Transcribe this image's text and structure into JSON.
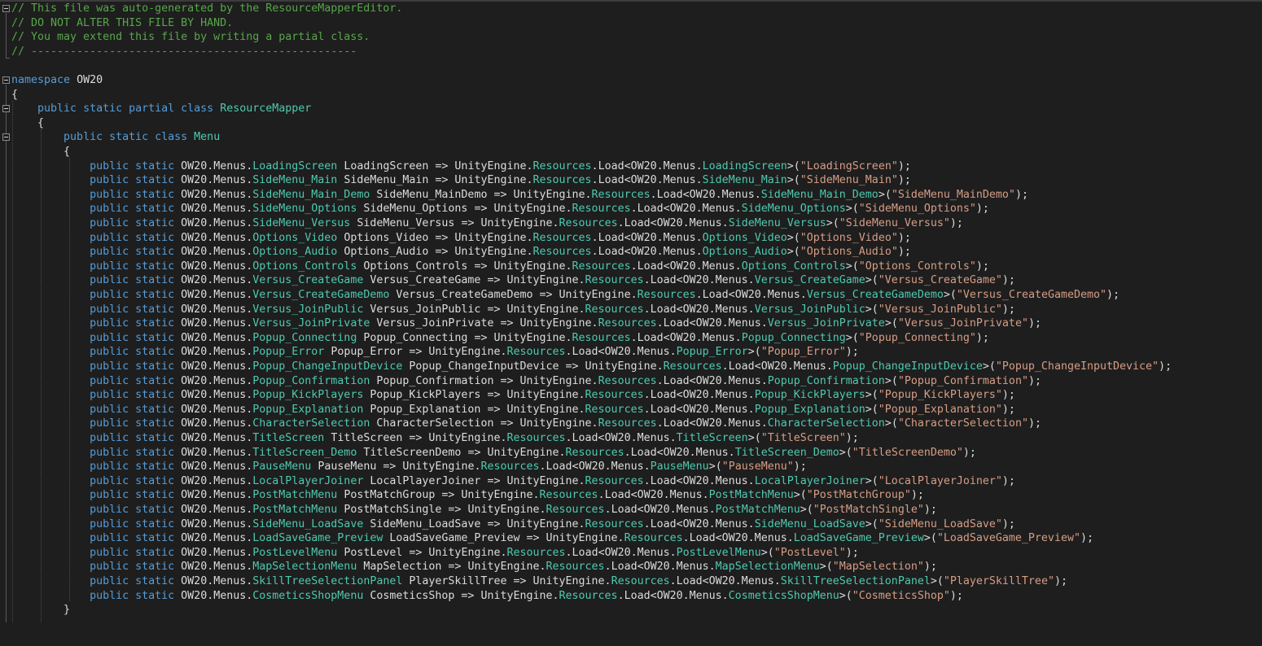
{
  "editor": {
    "header_comments": [
      "// This file was auto-generated by the ResourceMapperEditor.",
      "// DO NOT ALTER THIS FILE BY HAND.",
      "// You may extend this file by writing a partial class.",
      "// --------------------------------------------------"
    ],
    "namespace_kw": "namespace",
    "namespace_name": "OW20",
    "class_decl_kw": "public static partial class",
    "class_name": "ResourceMapper",
    "inner_decl_kw": "public static class",
    "inner_name": "Menu",
    "open_brace": "{",
    "close_brace": "}",
    "member_kw": "public static",
    "ns_prefix": "OW20.Menus.",
    "arrow": " => UnityEngine.",
    "resources": "Resources",
    "load": ".Load<OW20.Menus.",
    "suffix": ");",
    "members": [
      {
        "type": "LoadingScreen",
        "name": "LoadingScreen",
        "key": "\"LoadingScreen\""
      },
      {
        "type": "SideMenu_Main",
        "name": "SideMenu_Main",
        "key": "\"SideMenu_Main\""
      },
      {
        "type": "SideMenu_Main_Demo",
        "name": "SideMenu_MainDemo",
        "key": "\"SideMenu_MainDemo\""
      },
      {
        "type": "SideMenu_Options",
        "name": "SideMenu_Options",
        "key": "\"SideMenu_Options\""
      },
      {
        "type": "SideMenu_Versus",
        "name": "SideMenu_Versus",
        "key": "\"SideMenu_Versus\""
      },
      {
        "type": "Options_Video",
        "name": "Options_Video",
        "key": "\"Options_Video\""
      },
      {
        "type": "Options_Audio",
        "name": "Options_Audio",
        "key": "\"Options_Audio\""
      },
      {
        "type": "Options_Controls",
        "name": "Options_Controls",
        "key": "\"Options_Controls\""
      },
      {
        "type": "Versus_CreateGame",
        "name": "Versus_CreateGame",
        "key": "\"Versus_CreateGame\""
      },
      {
        "type": "Versus_CreateGameDemo",
        "name": "Versus_CreateGameDemo",
        "key": "\"Versus_CreateGameDemo\""
      },
      {
        "type": "Versus_JoinPublic",
        "name": "Versus_JoinPublic",
        "key": "\"Versus_JoinPublic\""
      },
      {
        "type": "Versus_JoinPrivate",
        "name": "Versus_JoinPrivate",
        "key": "\"Versus_JoinPrivate\""
      },
      {
        "type": "Popup_Connecting",
        "name": "Popup_Connecting",
        "key": "\"Popup_Connecting\""
      },
      {
        "type": "Popup_Error",
        "name": "Popup_Error",
        "key": "\"Popup_Error\""
      },
      {
        "type": "Popup_ChangeInputDevice",
        "name": "Popup_ChangeInputDevice",
        "key": "\"Popup_ChangeInputDevice\""
      },
      {
        "type": "Popup_Confirmation",
        "name": "Popup_Confirmation",
        "key": "\"Popup_Confirmation\""
      },
      {
        "type": "Popup_KickPlayers",
        "name": "Popup_KickPlayers",
        "key": "\"Popup_KickPlayers\""
      },
      {
        "type": "Popup_Explanation",
        "name": "Popup_Explanation",
        "key": "\"Popup_Explanation\""
      },
      {
        "type": "CharacterSelection",
        "name": "CharacterSelection",
        "key": "\"CharacterSelection\""
      },
      {
        "type": "TitleScreen",
        "name": "TitleScreen",
        "key": "\"TitleScreen\""
      },
      {
        "type": "TitleScreen_Demo",
        "name": "TitleScreenDemo",
        "key": "\"TitleScreenDemo\""
      },
      {
        "type": "PauseMenu",
        "name": "PauseMenu",
        "key": "\"PauseMenu\""
      },
      {
        "type": "LocalPlayerJoiner",
        "name": "LocalPlayerJoiner",
        "key": "\"LocalPlayerJoiner\""
      },
      {
        "type": "PostMatchMenu",
        "name": "PostMatchGroup",
        "key": "\"PostMatchGroup\""
      },
      {
        "type": "PostMatchMenu",
        "name": "PostMatchSingle",
        "key": "\"PostMatchSingle\""
      },
      {
        "type": "SideMenu_LoadSave",
        "name": "SideMenu_LoadSave",
        "key": "\"SideMenu_LoadSave\""
      },
      {
        "type": "LoadSaveGame_Preview",
        "name": "LoadSaveGame_Preview",
        "key": "\"LoadSaveGame_Preview\""
      },
      {
        "type": "PostLevelMenu",
        "name": "PostLevel",
        "key": "\"PostLevel\""
      },
      {
        "type": "MapSelectionMenu",
        "name": "MapSelection",
        "key": "\"MapSelection\""
      },
      {
        "type": "SkillTreeSelectionPanel",
        "name": "PlayerSkillTree",
        "key": "\"PlayerSkillTree\""
      },
      {
        "type": "CosmeticsShopMenu",
        "name": "CosmeticsShop",
        "key": "\"CosmeticsShop\""
      }
    ]
  },
  "colors": {
    "background": "#1e1e1e",
    "comment": "#57a64a",
    "keyword": "#569cd6",
    "type": "#4ec9b0",
    "string": "#d69d85",
    "text": "#dcdcdc"
  }
}
